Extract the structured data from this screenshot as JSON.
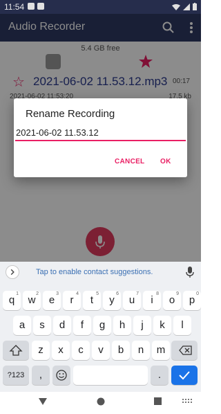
{
  "status_bar": {
    "time": "11:54"
  },
  "app": {
    "title": "Audio Recorder"
  },
  "storage": {
    "text": "5.4 GB free"
  },
  "recording": {
    "title": "2021-06-02 11.53.12.mp3",
    "duration": "00:17",
    "meta_left": "2021-06-02 11:53:20",
    "meta_right": "17.5 kb"
  },
  "dialog": {
    "title": "Rename Recording",
    "input_value": "2021-06-02 11.53.12",
    "cancel_label": "CANCEL",
    "ok_label": "OK"
  },
  "keyboard": {
    "suggestion_text": "Tap to enable contact suggestions.",
    "row1": [
      {
        "k": "q",
        "s": "1"
      },
      {
        "k": "w",
        "s": "2"
      },
      {
        "k": "e",
        "s": "3"
      },
      {
        "k": "r",
        "s": "4"
      },
      {
        "k": "t",
        "s": "5"
      },
      {
        "k": "y",
        "s": "6"
      },
      {
        "k": "u",
        "s": "7"
      },
      {
        "k": "i",
        "s": "8"
      },
      {
        "k": "o",
        "s": "9"
      },
      {
        "k": "p",
        "s": "0"
      }
    ],
    "row2": [
      "a",
      "s",
      "d",
      "f",
      "g",
      "h",
      "j",
      "k",
      "l"
    ],
    "row3": [
      "z",
      "x",
      "c",
      "v",
      "b",
      "n",
      "m"
    ],
    "symbols_label": "?123",
    "comma_label": ",",
    "period_label": "."
  },
  "colors": {
    "accent": "#e91e63",
    "appbar": "#2f3a63",
    "statusbar": "#262d4c",
    "enter": "#1a73e8"
  }
}
